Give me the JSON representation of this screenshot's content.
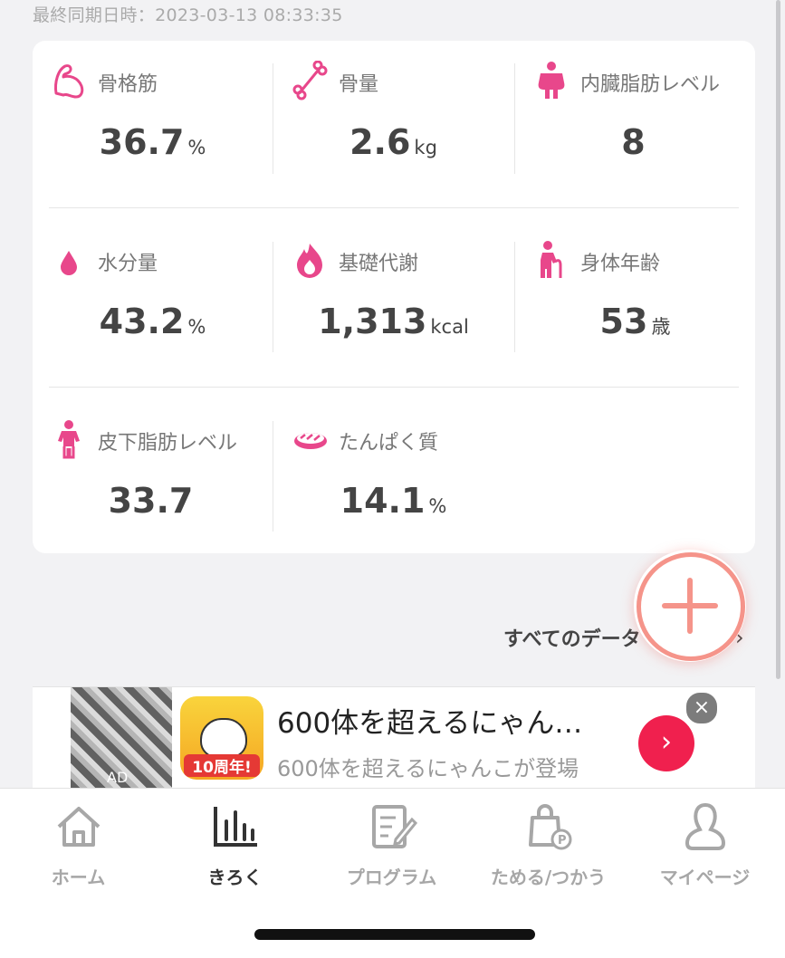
{
  "last_sync": "最終同期日時：2023-03-13 08:33:35",
  "metrics": [
    {
      "label": "骨格筋",
      "value": "36.7",
      "unit": "%",
      "icon": "muscle-arm-icon"
    },
    {
      "label": "骨量",
      "value": "2.6",
      "unit": "kg",
      "icon": "bone-icon"
    },
    {
      "label": "内臓脂肪レベル",
      "value": "8",
      "unit": "",
      "icon": "visceral-fat-icon"
    },
    {
      "label": "水分量",
      "value": "43.2",
      "unit": "%",
      "icon": "water-drop-icon"
    },
    {
      "label": "基礎代謝",
      "value": "1,313",
      "unit": "kcal",
      "icon": "flame-icon"
    },
    {
      "label": "身体年齢",
      "value": "53",
      "unit": "歳",
      "icon": "elder-person-icon"
    },
    {
      "label": "皮下脂肪レベル",
      "value": "33.7",
      "unit": "",
      "icon": "body-fat-icon"
    },
    {
      "label": "たんぱく質",
      "value": "14.1",
      "unit": "%",
      "icon": "meat-icon"
    }
  ],
  "all_data_link": "すべてのデータ",
  "ad": {
    "badge": "AD",
    "title": "600体を超えるにゃん…",
    "subtitle": "600体を超えるにゃんこが登場",
    "app_badge": "10周年!"
  },
  "tabs": [
    {
      "label": "ホーム",
      "icon": "home-icon",
      "active": false
    },
    {
      "label": "きろく",
      "icon": "bar-chart-icon",
      "active": true
    },
    {
      "label": "プログラム",
      "icon": "program-notebook-icon",
      "active": false
    },
    {
      "label": "ためる/つかう",
      "icon": "points-bag-icon",
      "active": false
    },
    {
      "label": "マイページ",
      "icon": "person-icon",
      "active": false
    }
  ],
  "colors": {
    "accent": "#e8478b",
    "fab": "#f5948a",
    "ad_button": "#f0204e"
  }
}
